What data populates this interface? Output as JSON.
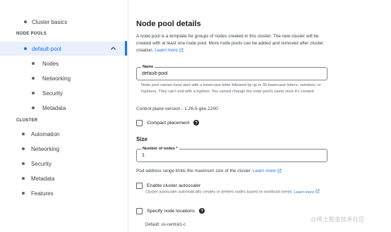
{
  "sidebar": {
    "top_item": {
      "label": "Cluster basics"
    },
    "node_pools_header": "NODE POOLS",
    "node_pool": {
      "label": "default-pool"
    },
    "node_pool_items": [
      {
        "label": "Nodes"
      },
      {
        "label": "Networking"
      },
      {
        "label": "Security"
      },
      {
        "label": "Metadata"
      }
    ],
    "cluster_header": "CLUSTER",
    "cluster_items": [
      {
        "label": "Automation"
      },
      {
        "label": "Networking"
      },
      {
        "label": "Security"
      },
      {
        "label": "Metadata"
      },
      {
        "label": "Features"
      }
    ]
  },
  "main": {
    "title": "Node pool details",
    "intro_text": "A node pool is a template for groups of nodes created in this cluster. The new cluster will be created with at least one node pool. More node pools can be added and removed after cluster creation.",
    "intro_link": "Learn more",
    "name_field": {
      "label": "Name",
      "value": "default-pool",
      "helper": "Node pool names must start with a lowercase letter followed by up to 39 lowercase letters, numbers, or hyphens. They can't end with a hyphen. You cannot change the node pool's name once it's created."
    },
    "control_plane_version": "Control plane version - 1.26.5-gke.1200",
    "compact_placement": {
      "label": "Compact placement",
      "checked": false
    },
    "size_heading": "Size",
    "nodes_field": {
      "label": "Number of nodes *",
      "value": "1"
    },
    "pod_address_text": "Pod address range limits the maximum size of the cluster.",
    "pod_address_link": "Learn more",
    "autoscaler": {
      "label": "Enable cluster autoscaler",
      "checked": false,
      "helper": "Cluster autoscaler automatically creates or deletes nodes based on workload needs.",
      "helper_link": "Learn more"
    },
    "node_locations": {
      "label": "Specify node locations",
      "checked": false
    },
    "default_location": "Default: us-central1-c"
  },
  "watermark": "@稀土掘金技术社区",
  "colors": {
    "accent": "#1a73e8",
    "active_bg": "#e8f0fe",
    "text": "#202124",
    "muted": "#5f6368"
  }
}
